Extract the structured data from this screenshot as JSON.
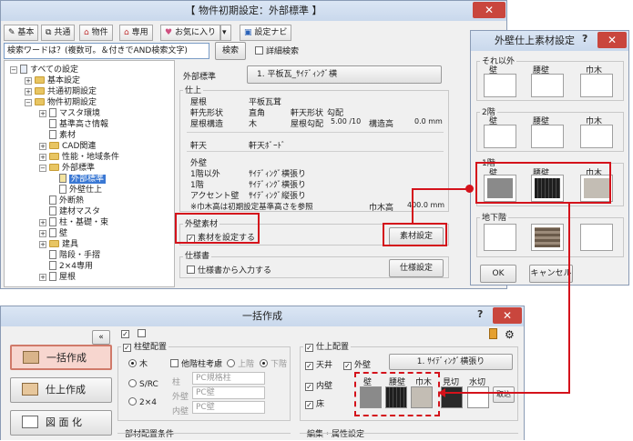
{
  "main_window": {
    "title": "【 物件初期設定：外部標準 】",
    "toolbar": {
      "basic": "基本",
      "common": "共通",
      "property": "物件",
      "dedicated": "専用",
      "favorites": "お気に入り",
      "navi": "設定ナビ"
    },
    "search_placeholder": "検索ワードは？(複数可。＆付きでAND検索文字)",
    "search_button": "検索",
    "detail_search": "詳細検索",
    "tree": {
      "root": "すべての設定",
      "basic": "基本設定",
      "common": "共通初期設定",
      "property": "物件初期設定",
      "master": "マスタ環境",
      "height": "基準高さ情報",
      "material": "素材",
      "cad": "CAD関連",
      "performance": "性能・地域条件",
      "exterior": "外部標準",
      "exterior_std": "外部標準",
      "exterior_finish": "外壁仕上",
      "insulation": "外断熱",
      "fixture_master": "建材マスタ",
      "column": "柱・基礎・束",
      "wall": "壁",
      "fitting": "建具",
      "stairs": "階段・手摺",
      "two_by_four": "2×4専用",
      "roof": "屋根"
    },
    "content": {
      "exterior_std_label": "外部標準",
      "exterior_std_value": "1. 平板瓦_ｻｲﾃﾞｨﾝｸﾞ横",
      "finish_label": "仕上",
      "roof_label": "屋根",
      "roof_value": "平板瓦茸",
      "eave_shape_label": "軒先形状",
      "eave_shape_value": "直角",
      "eave_ceiling_shape_label": "軒天形状",
      "eave_ceiling_shape_value": "勾配",
      "roof_structure_label": "屋根構造",
      "roof_structure_value": "木",
      "roof_pitch_label": "屋根勾配",
      "roof_pitch_value": "5.00 /10",
      "structure_height_label": "構造高",
      "structure_height_value": "0.0 mm",
      "eave_ceiling_label": "軒天",
      "eave_ceiling_value": "軒天ﾎﾞｰﾄﾞ",
      "outer_wall_label": "外壁",
      "floor1_other_label": "1階以外",
      "floor1_other_value": "ｻｲﾃﾞｨﾝｸﾞ横張り",
      "floor1_label": "1階",
      "floor1_value": "ｻｲﾃﾞｨﾝｸﾞ横張り",
      "accent_label": "アクセント壁",
      "accent_value": "ｻｲﾃﾞｨﾝｸﾞ縦張り",
      "note": "※巾木高は初期設定基準高さを参照",
      "baseboard_label": "巾木高",
      "baseboard_value": "400.0 mm",
      "material_group": "外壁素材",
      "set_material": "素材を設定する",
      "material_button": "素材設定",
      "spec_group": "仕様書",
      "input_from_spec": "仕様書から入力する",
      "spec_button": "仕様設定"
    }
  },
  "material_dialog": {
    "title": "外壁仕上素材設定",
    "other_group": "それ以外",
    "floor2_group": "2階",
    "floor1_group": "1階",
    "basement_group": "地下階",
    "col_wall": "壁",
    "col_wainscot": "腰壁",
    "col_baseboard": "巾木",
    "ok": "OK",
    "cancel": "キャンセル"
  },
  "bulk_window": {
    "title": "一括作成",
    "collapse": "«",
    "nav": {
      "bulk_create": "一括作成",
      "finish_create": "仕上作成",
      "drawing": "図 面 化"
    },
    "column_wall": "柱壁配置",
    "other_floor_consider": "他階柱考慮",
    "upper": "上階",
    "lower": "下階",
    "wood": "木",
    "src": "S/RC",
    "two_by_four": "2×4",
    "column_label": "柱",
    "column_value": "PC規格柱",
    "outer_wall_label": "外壁",
    "outer_wall_value": "PC壁",
    "inner_wall_label": "内壁",
    "inner_wall_value": "PC壁",
    "member_conditions": "部材配置条件",
    "finish_place": "仕上配置",
    "ceiling": "天井",
    "outer_wall": "外壁",
    "outer_wall_select": "1. ｻｲﾃﾞｨﾝｸﾞ横張り",
    "inner_wall": "内壁",
    "floor": "床",
    "col_wall": "壁",
    "col_wainscot": "腰壁",
    "col_baseboard": "巾木",
    "col_mikiri": "見切",
    "col_mizukiri": "水切",
    "import": "取込",
    "edit_attr": "編集・属性設定"
  },
  "colors": {
    "highlight_red": "#d4121b",
    "title_blue": "#c9d8ec",
    "swatch_gray": "#8a8a8a",
    "swatch_dark": "#2a2a2a",
    "swatch_beige": "#c3bdb4"
  }
}
